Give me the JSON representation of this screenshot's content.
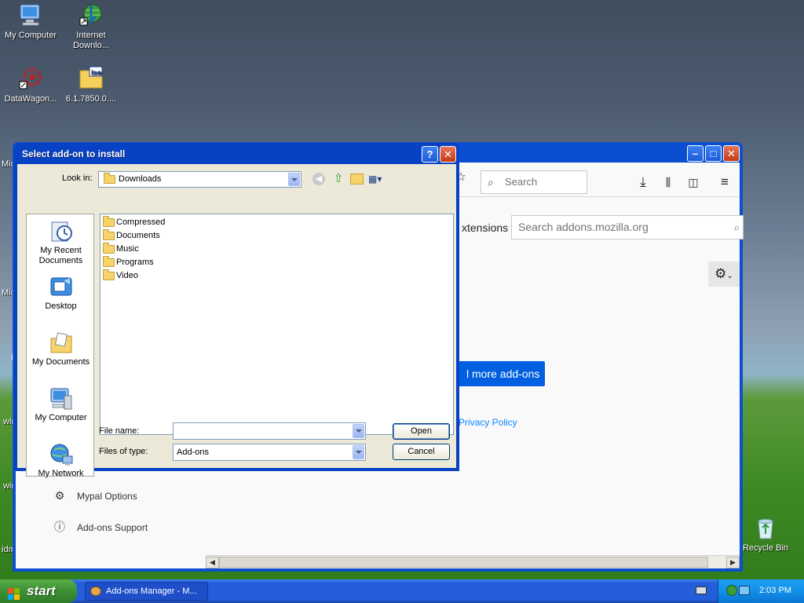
{
  "desktop": {
    "icons": [
      {
        "label": "My Computer"
      },
      {
        "label": "Internet Downlo..."
      },
      {
        "label": "DataWagon..."
      },
      {
        "label": "6.1.7850.0...."
      }
    ],
    "edge_labels": [
      "Mic",
      "Mic",
      "I",
      "wir",
      "wir",
      "idm"
    ],
    "recycle_bin": "Recycle Bin"
  },
  "firefox": {
    "search_placeholder": "Search",
    "addons_search_placeholder": "Search addons.mozilla.org",
    "section_label": "xtensions",
    "more_addons": "l more add-ons",
    "privacy_policy": "Privacy Policy",
    "sidebar": [
      {
        "label": "Mypal Options"
      },
      {
        "label": "Add-ons Support"
      }
    ]
  },
  "dialog": {
    "title": "Select add-on to install",
    "look_in_label": "Look in:",
    "look_in_value": "Downloads",
    "places": [
      "My Recent Documents",
      "Desktop",
      "My Documents",
      "My Computer",
      "My Network"
    ],
    "files": [
      "Compressed",
      "Documents",
      "Music",
      "Programs",
      "Video"
    ],
    "file_name_label": "File name:",
    "file_name_value": "",
    "files_of_type_label": "Files of type:",
    "files_of_type_value": "Add-ons",
    "open_button": "Open",
    "cancel_button": "Cancel"
  },
  "taskbar": {
    "start_label": "start",
    "task_item": "Add-ons Manager - M...",
    "clock": "2:03 PM"
  }
}
